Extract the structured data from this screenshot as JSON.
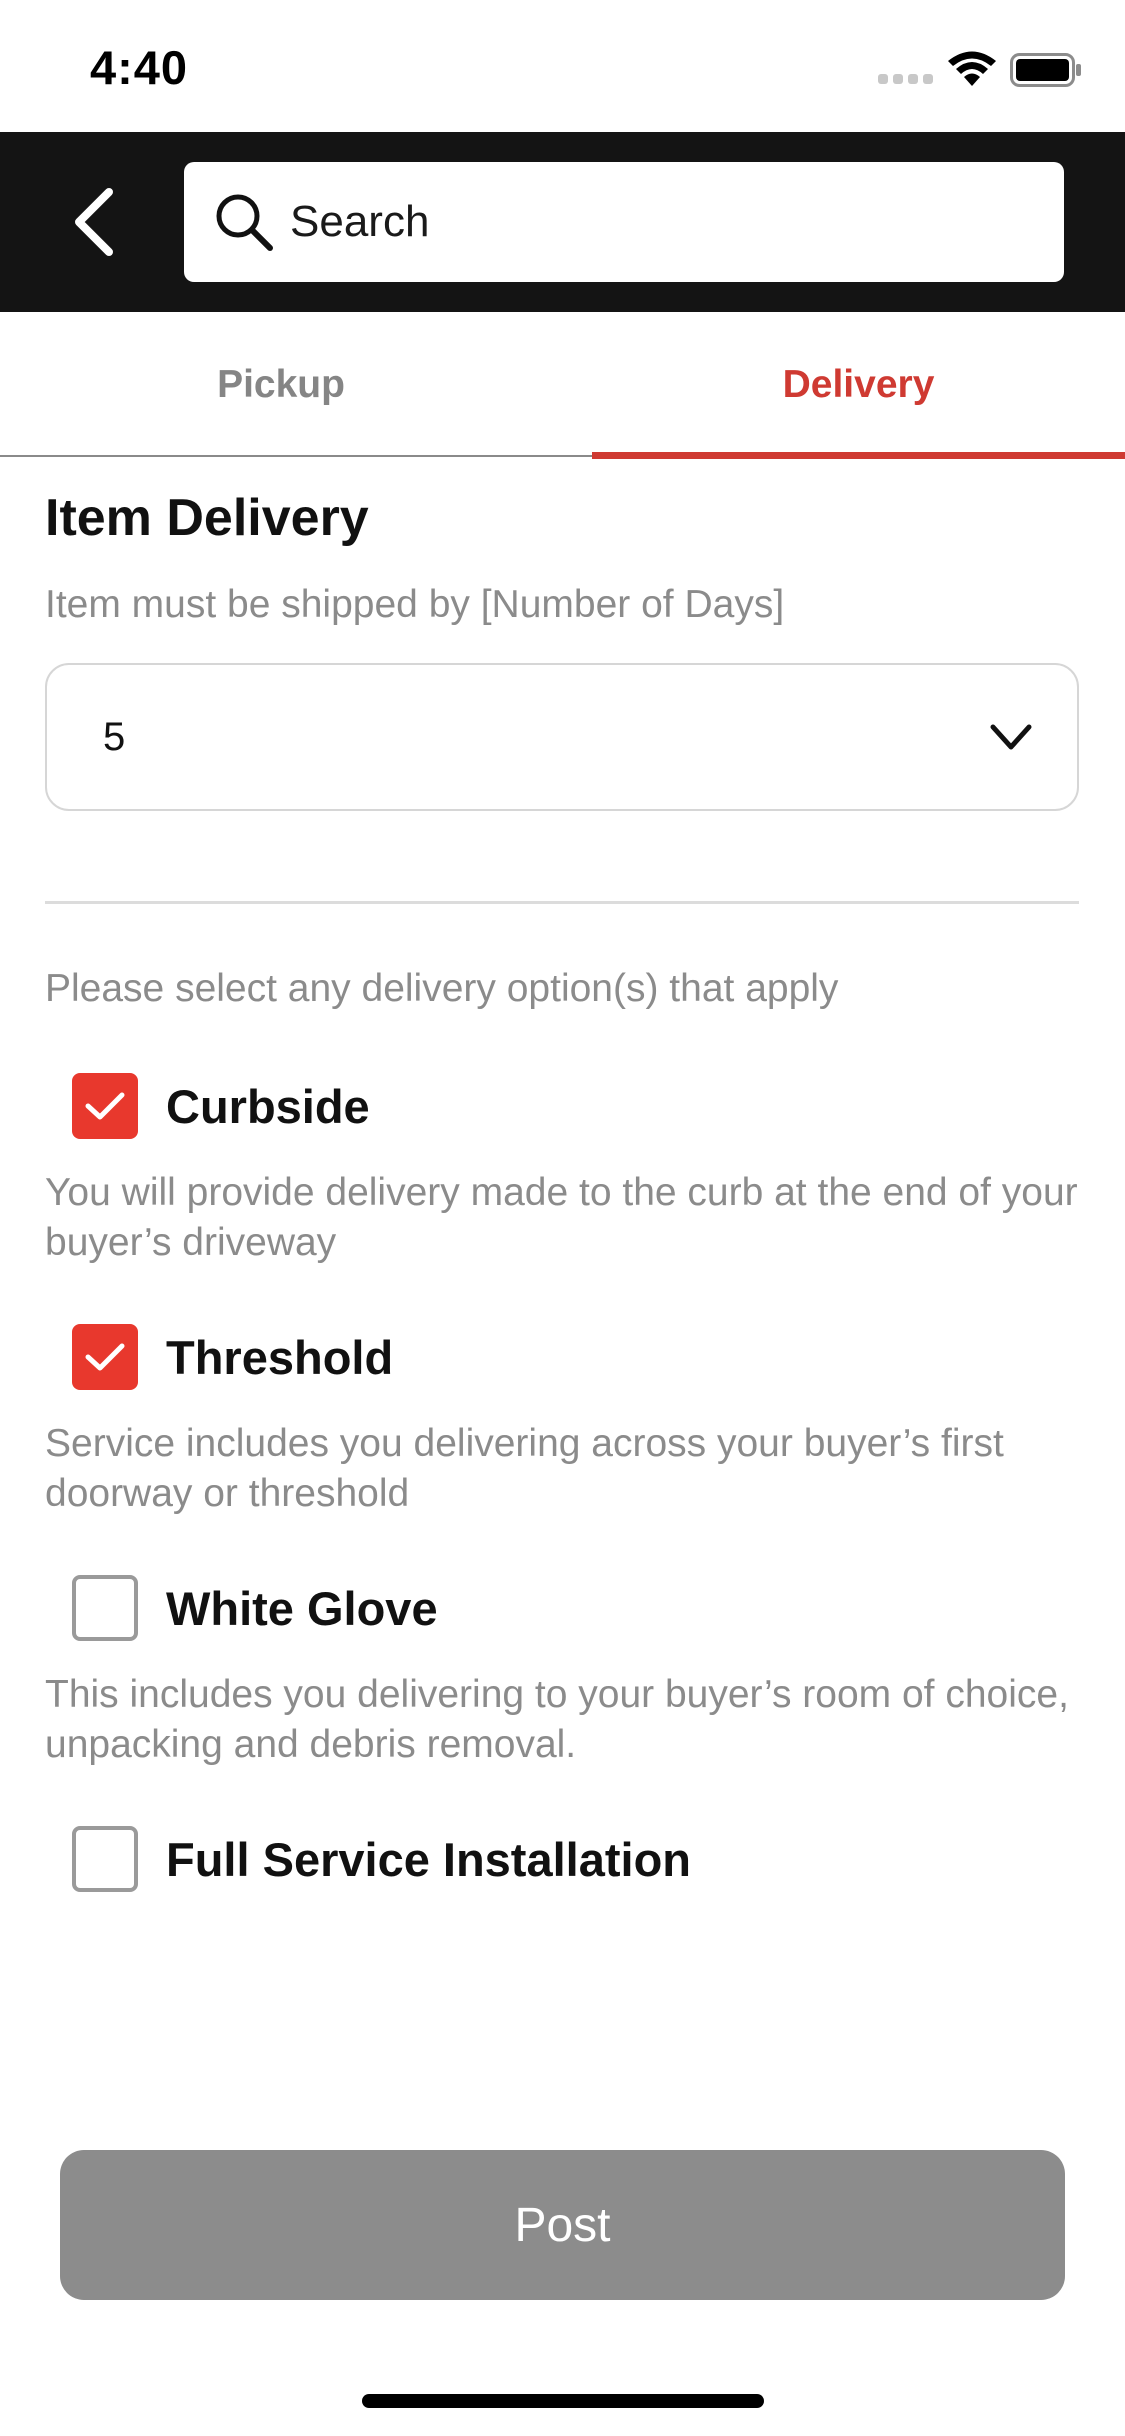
{
  "status_bar": {
    "time": "4:40"
  },
  "header": {
    "search_placeholder": "Search"
  },
  "tabs": [
    {
      "label": "Pickup",
      "active": false
    },
    {
      "label": "Delivery",
      "active": true
    }
  ],
  "delivery": {
    "title": "Item Delivery",
    "ship_by_label": "Item must be shipped by [Number of Days]",
    "ship_by_value": "5",
    "options_intro": "Please select any delivery option(s) that apply",
    "options": [
      {
        "label": "Curbside",
        "checked": true,
        "description": "You will provide delivery made to the curb at the end of your buyer’s driveway"
      },
      {
        "label": "Threshold",
        "checked": true,
        "description": "Service includes you delivering across your buyer’s first doorway or threshold"
      },
      {
        "label": "White Glove",
        "checked": false,
        "description": "This includes you delivering to your buyer’s room of choice, unpacking and debris removal."
      },
      {
        "label": "Full Service Installation",
        "checked": false,
        "description": ""
      }
    ]
  },
  "post_button": {
    "label": "Post"
  },
  "colors": {
    "accent": "#cf3a32",
    "checkbox_checked": "#e8382d",
    "header_bg": "#141414",
    "button_disabled": "#8c8c8c"
  },
  "icons": [
    "back-arrow-icon",
    "search-icon",
    "chevron-down-icon",
    "checkmark-icon",
    "wifi-icon",
    "battery-icon",
    "signal-icon"
  ]
}
